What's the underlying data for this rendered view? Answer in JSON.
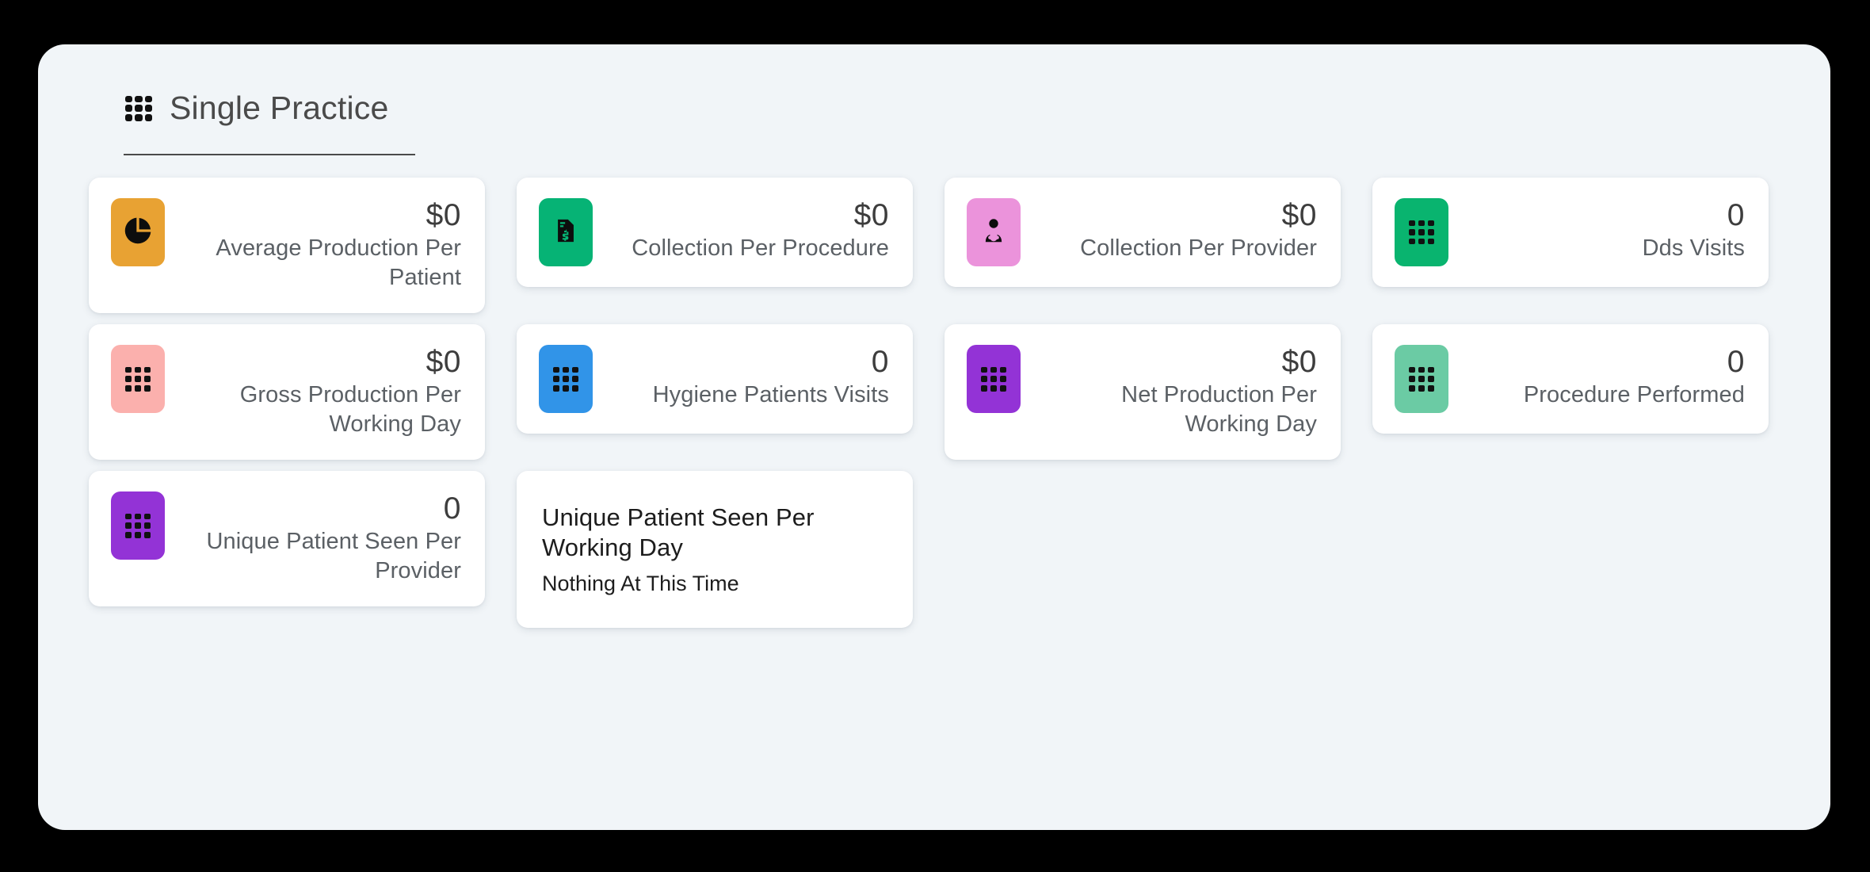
{
  "header": {
    "icon": "grid-3x3-icon",
    "title": "Single Practice"
  },
  "cards": [
    {
      "id": "average-production-per-patient",
      "icon": "pie-chart-icon",
      "color": "#E8A233",
      "value": "$0",
      "label": "Average Production Per Patient",
      "tall": true
    },
    {
      "id": "collection-per-procedure",
      "icon": "invoice-dollar-icon",
      "color": "#06B375",
      "value": "$0",
      "label": "Collection Per Procedure",
      "tall": false
    },
    {
      "id": "collection-per-provider",
      "icon": "doctor-icon",
      "color": "#EB93DB",
      "value": "$0",
      "label": "Collection Per Provider",
      "tall": false
    },
    {
      "id": "dds-visits",
      "icon": "grid-3x3-icon",
      "color": "#09B46F",
      "value": "0",
      "label": "Dds Visits",
      "tall": false
    },
    {
      "id": "gross-production-per-working-day",
      "icon": "grid-3x3-icon",
      "color": "#FBB0AD",
      "value": "$0",
      "label": "Gross Production Per Working Day",
      "tall": true
    },
    {
      "id": "hygiene-patients-visits",
      "icon": "grid-3x3-icon",
      "color": "#3194E8",
      "value": "0",
      "label": "Hygiene Patients Visits",
      "tall": false
    },
    {
      "id": "net-production-per-working-day",
      "icon": "grid-3x3-icon",
      "color": "#9333D6",
      "value": "$0",
      "label": "Net Production Per Working Day",
      "tall": true
    },
    {
      "id": "procedure-performed",
      "icon": "grid-3x3-icon",
      "color": "#6BCBA4",
      "value": "0",
      "label": "Procedure Performed",
      "tall": false
    },
    {
      "id": "unique-patient-seen-per-provider",
      "icon": "grid-3x3-icon",
      "color": "#9333D6",
      "value": "0",
      "label": "Unique Patient Seen Per Provider",
      "tall": true
    }
  ],
  "message_card": {
    "id": "unique-patient-seen-per-working-day",
    "title": "Unique Patient Seen Per Working Day",
    "subtitle": "Nothing At This Time"
  }
}
